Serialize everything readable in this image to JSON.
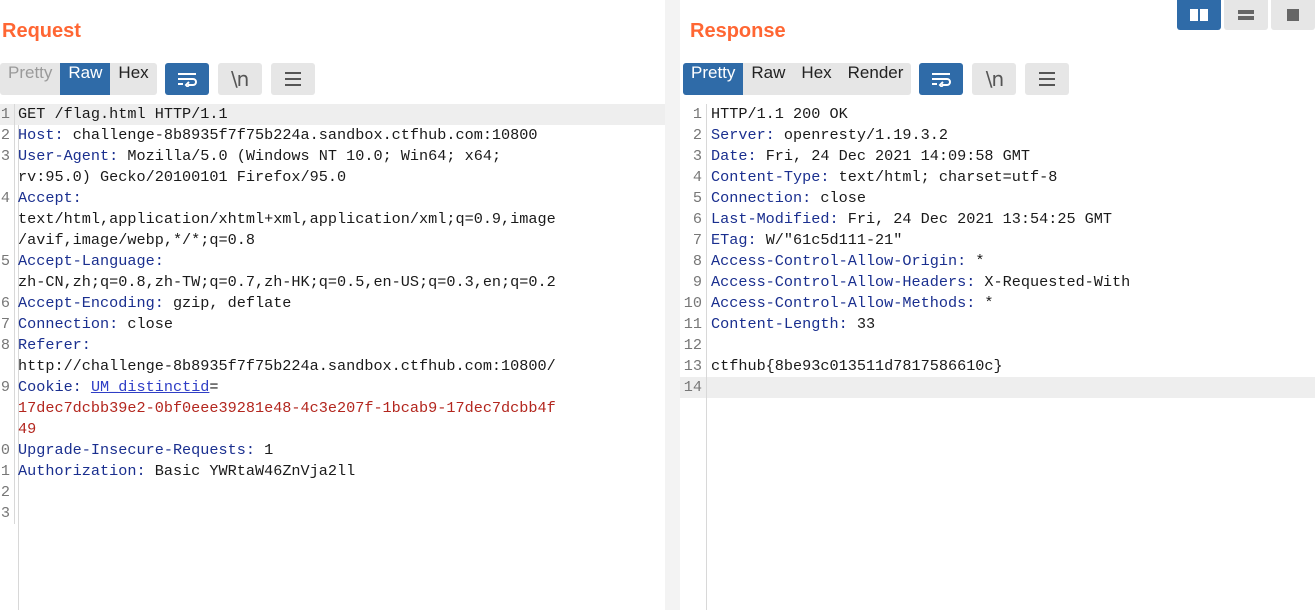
{
  "request": {
    "title": "Request",
    "tabs": [
      "Pretty",
      "Raw",
      "Hex"
    ],
    "active_tab": "Raw",
    "wrap_label": "\\n",
    "lines": [
      {
        "n": "1",
        "k": "",
        "v": "GET /flag.html HTTP/1.1"
      },
      {
        "n": "2",
        "k": "Host:",
        "v": " challenge-8b8935f7f75b224a.sandbox.ctfhub.com:10800"
      },
      {
        "n": "3",
        "k": "User-Agent:",
        "v": " Mozilla/5.0 (Windows NT 10.0; Win64; x64;"
      },
      {
        "n": "",
        "k": "",
        "v": "rv:95.0) Gecko/20100101 Firefox/95.0"
      },
      {
        "n": "4",
        "k": "Accept:",
        "v": ""
      },
      {
        "n": "",
        "k": "",
        "v": "text/html,application/xhtml+xml,application/xml;q=0.9,image"
      },
      {
        "n": "",
        "k": "",
        "v": "/avif,image/webp,*/*;q=0.8"
      },
      {
        "n": "5",
        "k": "Accept-Language:",
        "v": ""
      },
      {
        "n": "",
        "k": "",
        "v": "zh-CN,zh;q=0.8,zh-TW;q=0.7,zh-HK;q=0.5,en-US;q=0.3,en;q=0.2"
      },
      {
        "n": "6",
        "k": "Accept-Encoding:",
        "v": " gzip, deflate"
      },
      {
        "n": "7",
        "k": "Connection:",
        "v": " close"
      },
      {
        "n": "8",
        "k": "Referer:",
        "v": ""
      },
      {
        "n": "",
        "k": "",
        "v": "http://challenge-8b8935f7f75b224a.sandbox.ctfhub.com:10800/"
      },
      {
        "n": "9",
        "k": "Cookie:",
        "cookie_key": "UM_distinctid",
        "v": "="
      },
      {
        "n": "",
        "k": "",
        "rv": "17dec7dcbb39e2-0bf0eee39281e48-4c3e207f-1bcab9-17dec7dcbb4f"
      },
      {
        "n": "",
        "k": "",
        "rv": "49"
      },
      {
        "n": "0",
        "k": "Upgrade-Insecure-Requests:",
        "v": " 1"
      },
      {
        "n": "1",
        "k": "Authorization:",
        "v": " Basic YWRtaW46ZnVja2ll"
      },
      {
        "n": "2",
        "k": "",
        "v": ""
      },
      {
        "n": "3",
        "k": "",
        "v": ""
      }
    ]
  },
  "response": {
    "title": "Response",
    "tabs": [
      "Pretty",
      "Raw",
      "Hex",
      "Render"
    ],
    "active_tab": "Pretty",
    "wrap_label": "\\n",
    "lines": [
      {
        "n": "1",
        "k": "",
        "v": "HTTP/1.1 200 OK"
      },
      {
        "n": "2",
        "k": "Server:",
        "v": " openresty/1.19.3.2"
      },
      {
        "n": "3",
        "k": "Date:",
        "v": " Fri, 24 Dec 2021 14:09:58 GMT"
      },
      {
        "n": "4",
        "k": "Content-Type:",
        "v": " text/html; charset=utf-8"
      },
      {
        "n": "5",
        "k": "Connection:",
        "v": " close"
      },
      {
        "n": "6",
        "k": "Last-Modified:",
        "v": " Fri, 24 Dec 2021 13:54:25 GMT"
      },
      {
        "n": "7",
        "k": "ETag:",
        "v": " W/\"61c5d111-21\""
      },
      {
        "n": "8",
        "k": "Access-Control-Allow-Origin:",
        "v": " *"
      },
      {
        "n": "9",
        "k": "Access-Control-Allow-Headers:",
        "v": " X-Requested-With"
      },
      {
        "n": "10",
        "k": "Access-Control-Allow-Methods:",
        "v": " *"
      },
      {
        "n": "11",
        "k": "Content-Length:",
        "v": " 33"
      },
      {
        "n": "12",
        "k": "",
        "v": ""
      },
      {
        "n": "13",
        "k": "",
        "v": "ctfhub{8be93c013511d7817586610c}"
      },
      {
        "n": "14",
        "k": "",
        "v": ""
      }
    ]
  },
  "colors": {
    "title": "#ff6633",
    "active": "#2f6ba8",
    "header_key": "#1a2f8f",
    "cookie_value": "#b3261e"
  },
  "icons": {
    "wrap": "wrap-lines-icon",
    "newline": "show-newlines-icon",
    "menu": "hamburger-menu-icon",
    "layout_split": "split-columns-icon",
    "layout_rows": "split-rows-icon",
    "layout_single": "single-pane-icon"
  }
}
